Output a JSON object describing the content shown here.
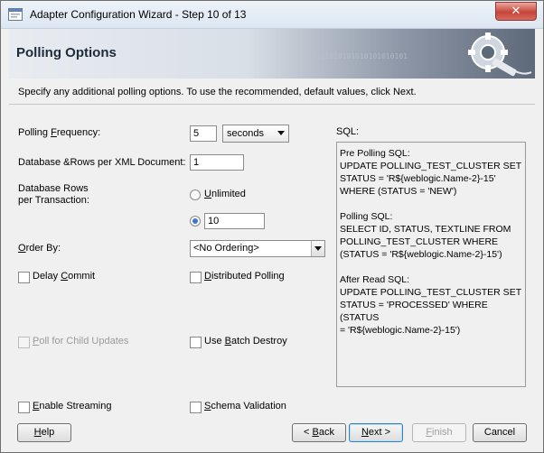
{
  "window": {
    "title": "Adapter Configuration Wizard - Step 10 of 13",
    "close_label": "✕"
  },
  "header": {
    "title": "Polling Options",
    "decoration": "0101010101010101010101"
  },
  "instruction": "Specify any additional polling options.  To use the recommended, default values, click Next.",
  "form": {
    "polling_frequency": {
      "label_pre": "Polling ",
      "label_mn": "F",
      "label_post": "requency:",
      "value": "5",
      "unit": "seconds"
    },
    "rows_per_xml": {
      "label": "Database &Rows per XML Document:",
      "value": "1"
    },
    "rows_per_tx": {
      "label_line1": "Database Rows",
      "label_line2": "per Transaction:",
      "unlimited": {
        "pre": "",
        "mn": "U",
        "post": "nlimited",
        "selected": false
      },
      "value": "10"
    },
    "order_by": {
      "label_pre": "",
      "label_mn": "O",
      "label_post": "rder By:",
      "value": "<No Ordering>"
    },
    "delay_commit": {
      "pre": "Delay ",
      "mn": "C",
      "post": "ommit",
      "checked": false
    },
    "distributed_polling": {
      "pre": "",
      "mn": "D",
      "post": "istributed Polling",
      "checked": false
    },
    "poll_child": {
      "pre": "",
      "mn": "P",
      "post": "oll for Child Updates",
      "checked": false,
      "disabled": true
    },
    "batch_destroy": {
      "pre": "Use ",
      "mn": "B",
      "post": "atch Destroy",
      "checked": false
    },
    "enable_streaming": {
      "pre": "",
      "mn": "E",
      "post": "nable Streaming",
      "checked": false
    },
    "schema_validation": {
      "pre": "",
      "mn": "S",
      "post": "chema Validation",
      "checked": false
    }
  },
  "sql": {
    "label": "SQL:",
    "blocks": [
      "Pre Polling SQL:\nUPDATE POLLING_TEST_CLUSTER SET\nSTATUS = 'R${weblogic.Name-2}-15'\nWHERE (STATUS = 'NEW')",
      "Polling SQL:\nSELECT ID, STATUS, TEXTLINE FROM\nPOLLING_TEST_CLUSTER WHERE\n(STATUS = 'R${weblogic.Name-2}-15')",
      "After Read SQL:\nUPDATE POLLING_TEST_CLUSTER SET\nSTATUS = 'PROCESSED' WHERE (STATUS\n= 'R${weblogic.Name-2}-15')"
    ]
  },
  "buttons": {
    "help": {
      "pre": "",
      "mn": "H",
      "post": "elp"
    },
    "back": {
      "pre": "< ",
      "mn": "B",
      "post": "ack"
    },
    "next": {
      "pre": "",
      "mn": "N",
      "post": "ext >"
    },
    "finish": {
      "pre": "",
      "mn": "F",
      "post": "inish"
    },
    "cancel": {
      "pre": "Cancel",
      "mn": "",
      "post": ""
    }
  },
  "colors": {
    "accent": "#3a78c9",
    "close": "#c8453a"
  }
}
